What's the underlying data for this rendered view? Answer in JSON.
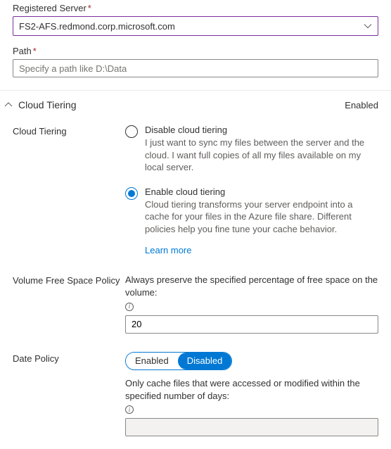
{
  "fields": {
    "registered_server": {
      "label": "Registered Server",
      "required_mark": "*",
      "value": "FS2-AFS.redmond.corp.microsoft.com"
    },
    "path": {
      "label": "Path",
      "required_mark": "*",
      "placeholder": "Specify a path like D:\\Data",
      "value": ""
    }
  },
  "section": {
    "title": "Cloud Tiering",
    "status": "Enabled"
  },
  "cloud_tiering": {
    "label": "Cloud Tiering",
    "options": {
      "disable": {
        "label": "Disable cloud tiering",
        "description": "I just want to sync my files between the server and the cloud. I want full copies of all my files available on my local server."
      },
      "enable": {
        "label": "Enable cloud tiering",
        "description": "Cloud tiering transforms your server endpoint into a cache for your files in the Azure file share. Different policies help you fine tune your cache behavior."
      }
    },
    "learn_more": "Learn more"
  },
  "volume_policy": {
    "label": "Volume Free Space Policy",
    "description": "Always preserve the specified percentage of free space on the volume:",
    "value": "20"
  },
  "date_policy": {
    "label": "Date Policy",
    "toggle": {
      "enabled": "Enabled",
      "disabled": "Disabled"
    },
    "description": "Only cache files that were accessed or modified within the specified number of days:",
    "value": ""
  }
}
